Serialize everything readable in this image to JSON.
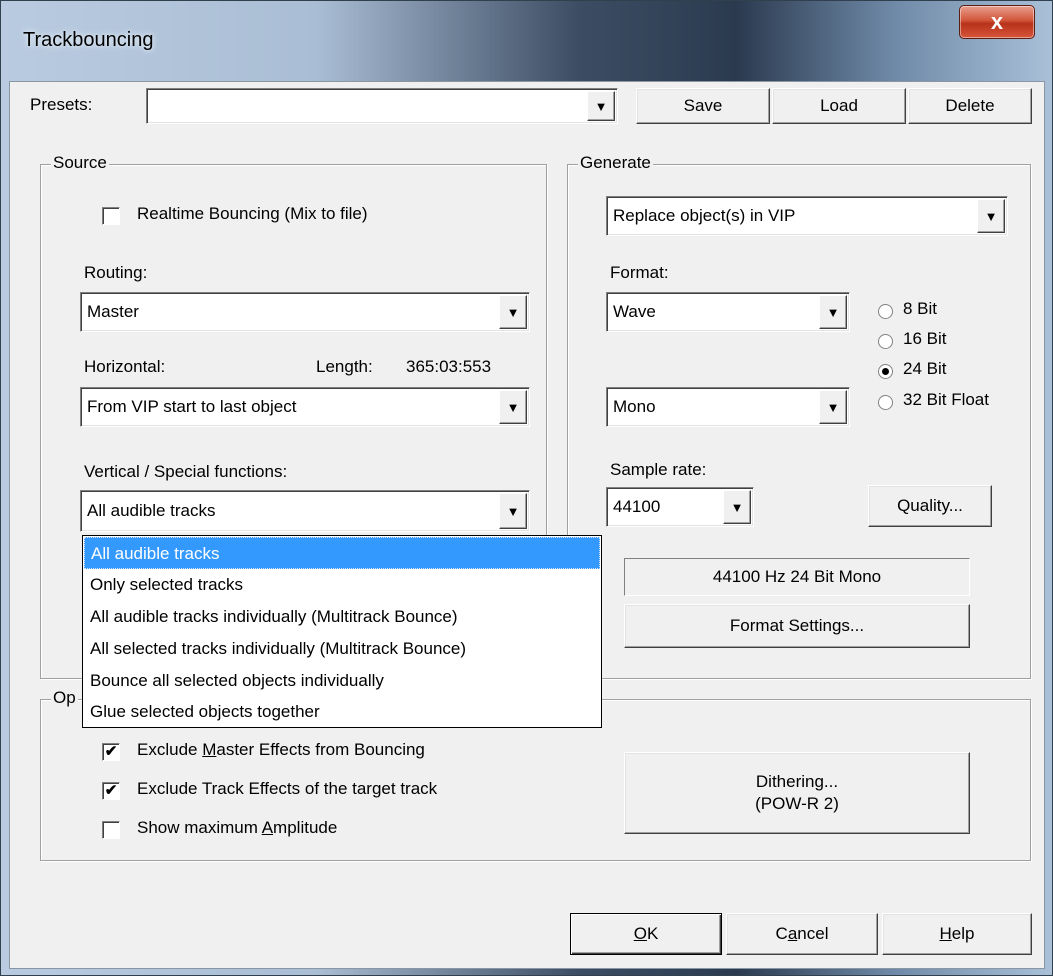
{
  "window": {
    "title": "Trackbouncing",
    "close_glyph": "x"
  },
  "presets": {
    "label": "Presets:",
    "value": "",
    "save": "Save",
    "load": "Load",
    "delete": "Delete"
  },
  "source": {
    "title": "Source",
    "realtime": {
      "label": "Realtime Bouncing (Mix to file)",
      "checked": false
    },
    "routing_label": "Routing:",
    "routing_value": "Master",
    "horizontal_label": "Horizontal:",
    "length_label": "Length:",
    "length_value": "365:03:553",
    "horizontal_value": "From VIP start to last object",
    "vertical_label": "Vertical / Special functions:",
    "vertical_value": "All audible tracks",
    "vertical_options": [
      "All audible tracks",
      "Only selected tracks",
      "All audible tracks individually  (Multitrack Bounce)",
      "All selected tracks individually  (Multitrack Bounce)",
      "Bounce all selected objects individually",
      "Glue selected objects together"
    ],
    "selected_option_index": 0
  },
  "generate": {
    "title": "Generate",
    "mode_value": "Replace object(s)  in VIP",
    "format_label": "Format:",
    "format_value": "Wave",
    "channels_value": "Mono",
    "bit_options": [
      "8 Bit",
      "16 Bit",
      "24 Bit",
      "32 Bit Float"
    ],
    "bit_selected": "24 Bit",
    "sample_rate_label": "Sample rate:",
    "sample_rate_value": "44100",
    "quality_button": "Quality...",
    "summary": "44100 Hz  24 Bit  Mono",
    "format_settings_button": "Format Settings..."
  },
  "options": {
    "title_visible": "Op",
    "exclude_master": {
      "label_pre": "Exclude ",
      "label_u": "M",
      "label_post": "aster Effects from Bouncing",
      "checked": true
    },
    "exclude_track": {
      "label": "Exclude Track Effects of the target track",
      "checked": true
    },
    "show_max": {
      "label_pre": "Show maximum ",
      "label_u": "A",
      "label_post": "mplitude",
      "checked": false
    },
    "dithering_line1": "Dithering...",
    "dithering_line2": "(POW-R 2)"
  },
  "footer": {
    "ok_u": "O",
    "ok_rest": "K",
    "cancel_pre": "C",
    "cancel_u": "a",
    "cancel_post": "ncel",
    "help_u": "H",
    "help_rest": "elp"
  },
  "icons": {
    "dropdown_arrow": "▼",
    "checkmark": "✔"
  }
}
